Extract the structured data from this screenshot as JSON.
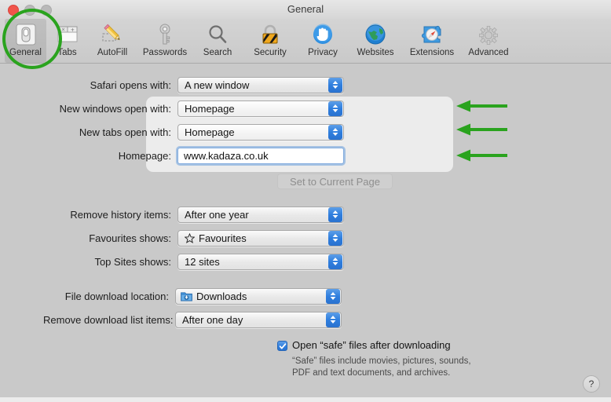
{
  "window": {
    "title": "General",
    "controls": {
      "close": "close-button",
      "minimize": "minimize-button",
      "maximize": "maximize-button"
    }
  },
  "toolbar": {
    "items": [
      {
        "label": "General",
        "icon": "general-switch-icon",
        "selected": true
      },
      {
        "label": "Tabs",
        "icon": "tabs-icon",
        "selected": false
      },
      {
        "label": "AutoFill",
        "icon": "autofill-pencil-icon",
        "selected": false
      },
      {
        "label": "Passwords",
        "icon": "passwords-key-icon",
        "selected": false
      },
      {
        "label": "Search",
        "icon": "search-magnifier-icon",
        "selected": false
      },
      {
        "label": "Security",
        "icon": "security-lock-icon",
        "selected": false
      },
      {
        "label": "Privacy",
        "icon": "privacy-hand-icon",
        "selected": false
      },
      {
        "label": "Websites",
        "icon": "websites-globe-icon",
        "selected": false
      },
      {
        "label": "Extensions",
        "icon": "extensions-puzzle-icon",
        "selected": false
      },
      {
        "label": "Advanced",
        "icon": "advanced-gear-icon",
        "selected": false
      }
    ]
  },
  "form": {
    "safari_opens_with": {
      "label": "Safari opens with:",
      "value": "A new window"
    },
    "new_windows_open_with": {
      "label": "New windows open with:",
      "value": "Homepage"
    },
    "new_tabs_open_with": {
      "label": "New tabs open with:",
      "value": "Homepage"
    },
    "homepage": {
      "label": "Homepage:",
      "value": "www.kadaza.co.uk",
      "placeholder": ""
    },
    "set_to_current_page": {
      "label": "Set to Current Page"
    },
    "remove_history_items": {
      "label": "Remove history items:",
      "value": "After one year"
    },
    "favourites_shows": {
      "label": "Favourites shows:",
      "value": "Favourites",
      "icon": "star-icon"
    },
    "top_sites_shows": {
      "label": "Top Sites shows:",
      "value": "12 sites"
    },
    "file_download_location": {
      "label": "File download location:",
      "value": "Downloads",
      "icon": "downloads-folder-icon"
    },
    "remove_download_items": {
      "label": "Remove download list items:",
      "value": "After one day"
    },
    "open_safe_files": {
      "label": "Open “safe” files after downloading",
      "checked": true,
      "note": "“Safe” files include movies, pictures, sounds, PDF and text documents, and archives."
    }
  },
  "help": {
    "label": "?",
    "icon": "help-question-icon"
  },
  "annotations": {
    "ellipse": {
      "target": "General toolbar item",
      "color": "#2aa31e"
    },
    "arrows": [
      {
        "points_to": "New windows open with",
        "color": "#2aa31e"
      },
      {
        "points_to": "New tabs open with",
        "color": "#2aa31e"
      },
      {
        "points_to": "Homepage field",
        "color": "#2aa31e"
      }
    ]
  },
  "colors": {
    "accent_blue": "#2f7ede",
    "annotation_green": "#2aa31e",
    "window_bg": "#c9c9c9",
    "panel_bg": "#ececec"
  }
}
